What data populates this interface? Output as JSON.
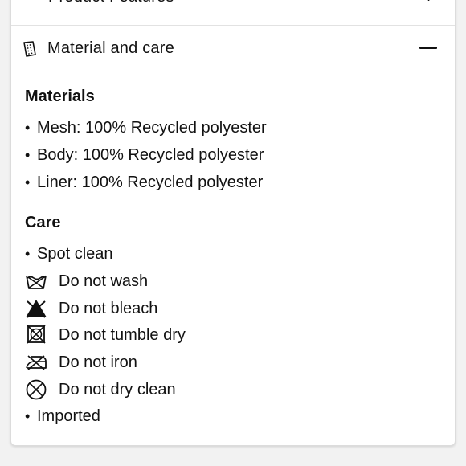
{
  "previous_section": {
    "title": "Product Features"
  },
  "section": {
    "title": "Material and care",
    "materials_heading": "Materials",
    "materials": [
      "Mesh: 100% Recycled polyester",
      "Body: 100% Recycled polyester",
      "Liner: 100% Recycled polyester"
    ],
    "care_heading": "Care",
    "care": [
      {
        "icon": "bullet",
        "text": "Spot clean"
      },
      {
        "icon": "do-not-wash-icon",
        "text": "Do not wash"
      },
      {
        "icon": "do-not-bleach-icon",
        "text": "Do not bleach"
      },
      {
        "icon": "do-not-tumble-dry-icon",
        "text": "Do not tumble dry"
      },
      {
        "icon": "do-not-iron-icon",
        "text": "Do not iron"
      },
      {
        "icon": "do-not-dry-clean-icon",
        "text": "Do not dry clean"
      },
      {
        "icon": "bullet",
        "text": "Imported"
      }
    ]
  },
  "colors": {
    "text": "#111111",
    "divider": "#e2e2e2",
    "background": "#f2f2f2"
  }
}
